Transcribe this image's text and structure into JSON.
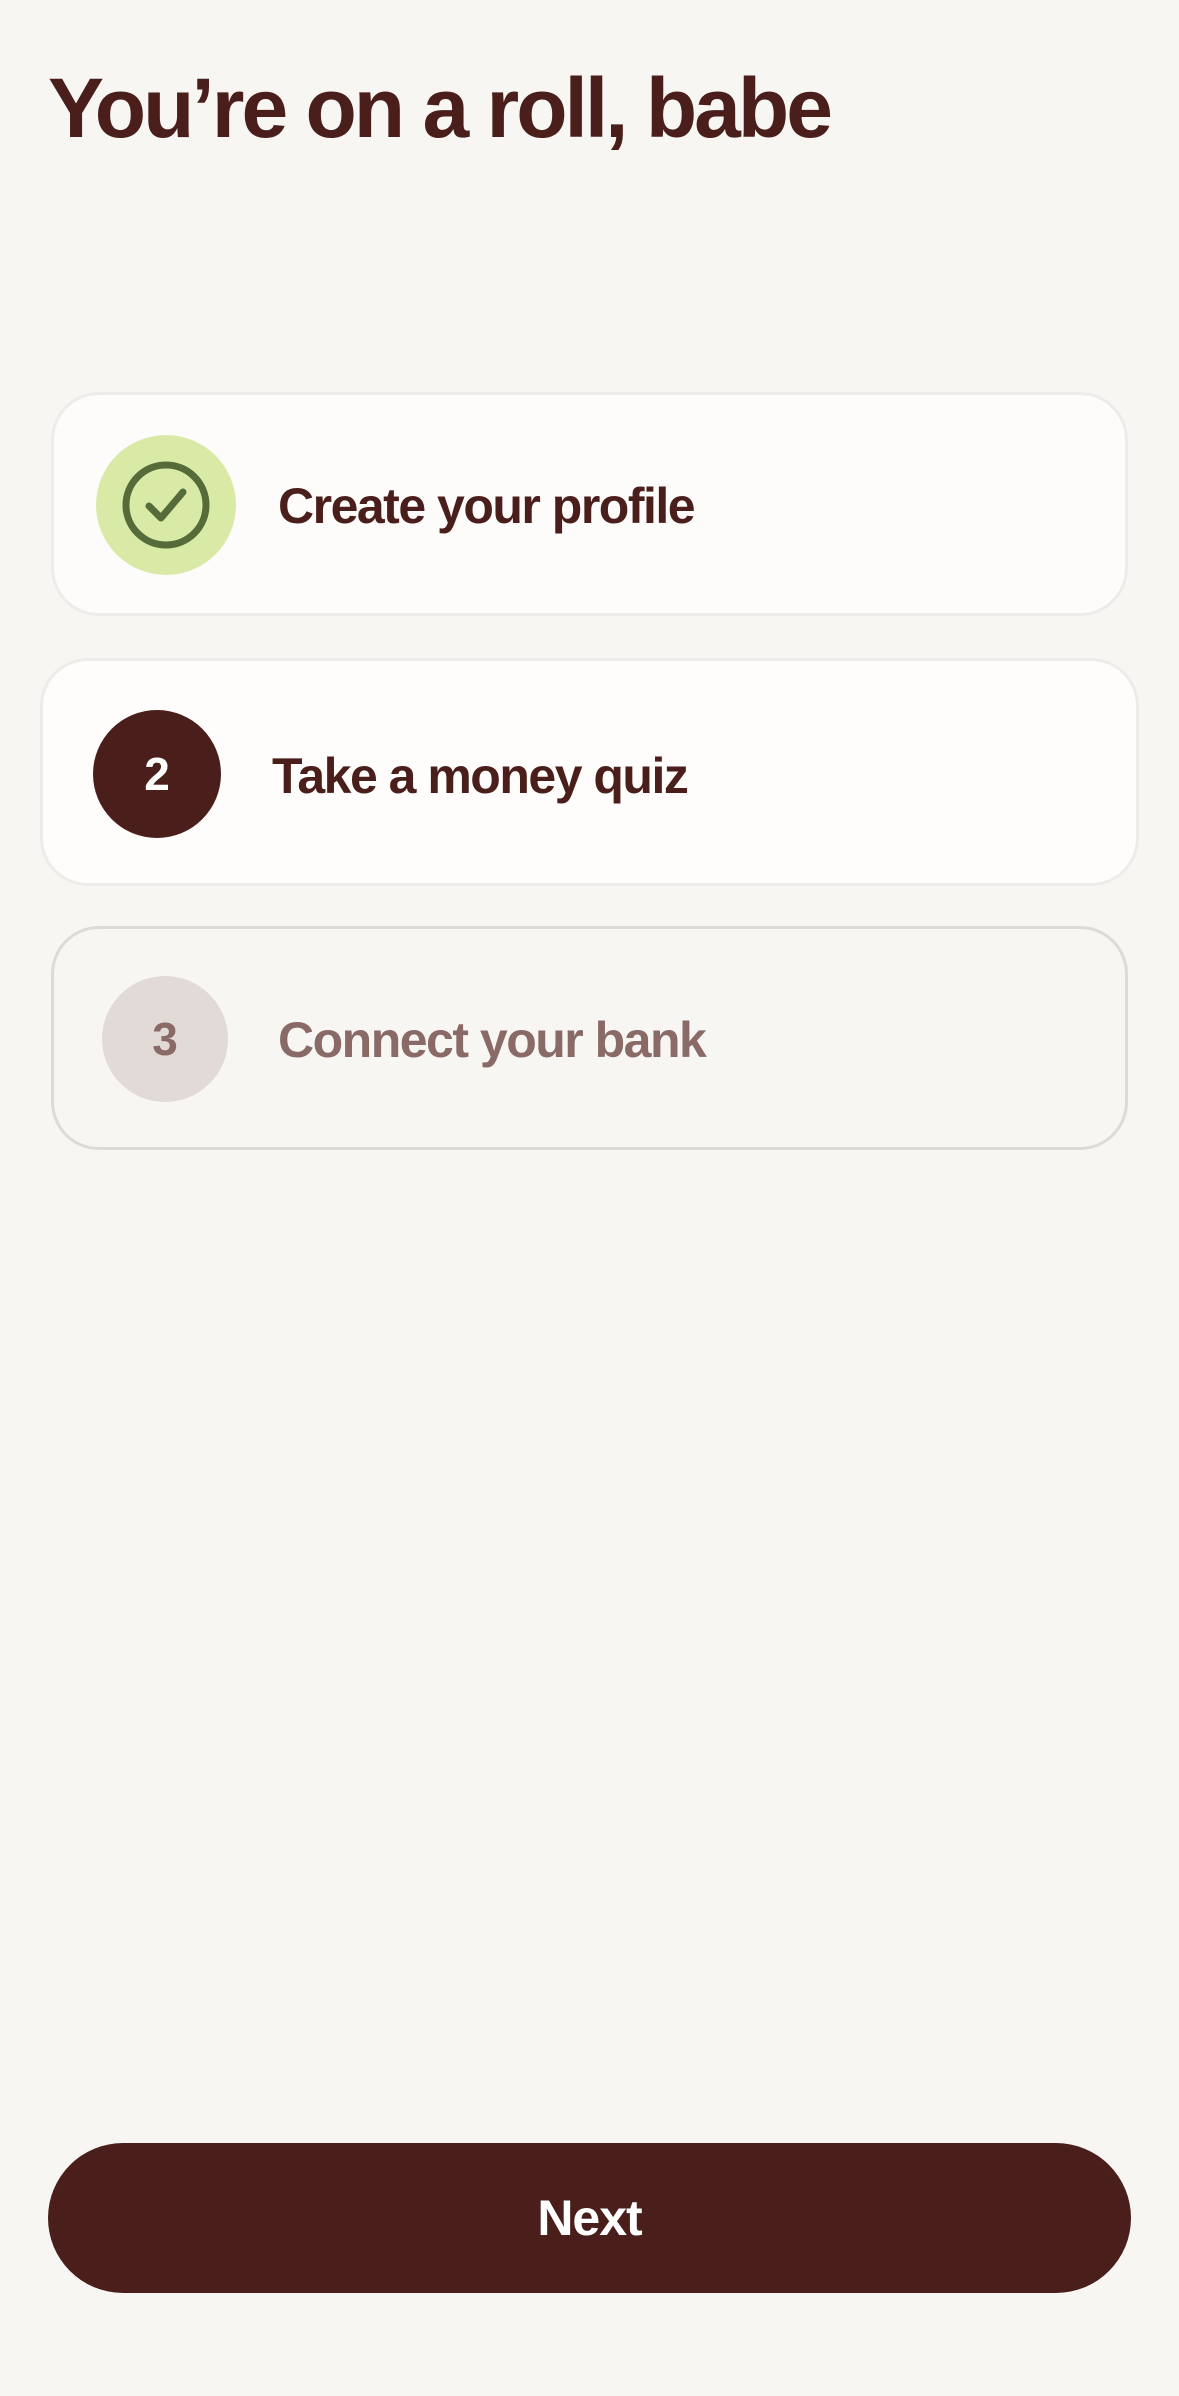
{
  "header": {
    "title": "You’re on a roll, babe"
  },
  "steps": [
    {
      "status": "completed",
      "icon": "check-circle-icon",
      "label": "Create your profile"
    },
    {
      "status": "current",
      "number": "2",
      "label": "Take a money quiz"
    },
    {
      "status": "upcoming",
      "number": "3",
      "label": "Connect your bank"
    }
  ],
  "footer": {
    "next_label": "Next"
  },
  "colors": {
    "background": "#f8f6f3",
    "primary": "#4a1f1b",
    "success_fill": "#d9eaa6",
    "success_stroke": "#556b3a",
    "muted_text": "#8a6a66",
    "muted_fill": "#e1dad7"
  }
}
